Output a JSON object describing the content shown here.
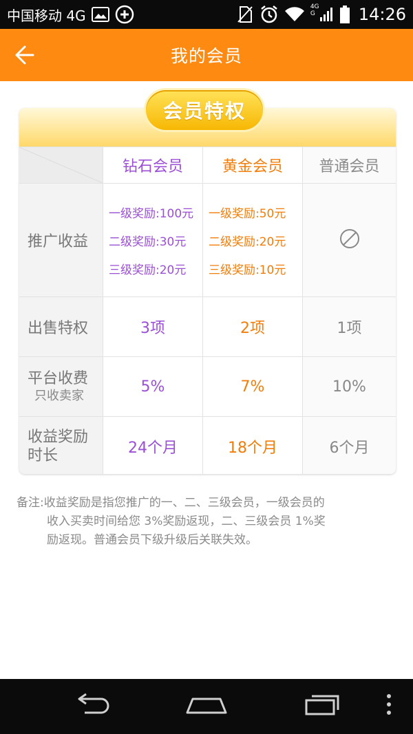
{
  "status_bar": {
    "carrier": "中国移动 4G",
    "time": "14:26",
    "network_label_top": "4G",
    "network_label_bottom": "G",
    "icons": [
      "image-icon",
      "plus-circle-icon",
      "no-sim-icon",
      "alarm-icon",
      "wifi-icon",
      "signal-icon",
      "battery-icon"
    ]
  },
  "header": {
    "title": "我的会员",
    "back_icon": "arrow-left-icon",
    "accent_color": "#ff8a12"
  },
  "card": {
    "ribbon": "会员特权",
    "columns": [
      "钻石会员",
      "黄金会员",
      "普通会员"
    ],
    "colors": {
      "diamond": "#9b4fd6",
      "gold": "#f27d0a",
      "normal": "#888888"
    },
    "rows": {
      "promotion": {
        "label": "推广收益",
        "diamond": [
          "一级奖励:100元",
          "二级奖励:30元",
          "三级奖励:20元"
        ],
        "gold": [
          "一级奖励:50元",
          "二级奖励:20元",
          "三级奖励:10元"
        ],
        "normal_icon": "prohibited-icon"
      },
      "sale": {
        "label": "出售特权",
        "diamond": "3项",
        "gold": "2项",
        "normal": "1项"
      },
      "fee": {
        "label": "平台收费",
        "sublabel": "只收卖家",
        "diamond": "5%",
        "gold": "7%",
        "normal": "10%"
      },
      "duration": {
        "label_line1": "收益奖励",
        "label_line2": "时长",
        "diamond": "24个月",
        "gold": "18个月",
        "normal": "6个月"
      }
    }
  },
  "note": {
    "line1": "备注:收益奖励是指您推广的一、二、三级会员，一级会员的",
    "line2": "收入买卖时间给您 3%奖励返现，二、三级会员 1%奖",
    "line3": "励返现。普通会员下级升级后关联失效。"
  },
  "nav_bar": {
    "icons": [
      "back-nav-icon",
      "home-nav-icon",
      "recents-nav-icon",
      "overflow-menu-icon"
    ]
  }
}
